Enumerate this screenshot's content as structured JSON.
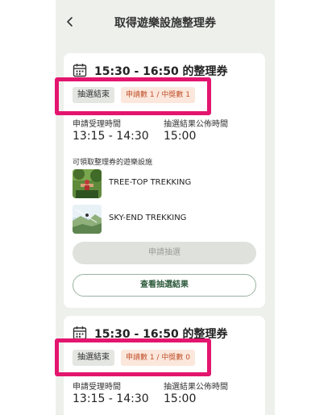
{
  "header": {
    "title": "取得遊樂設施整理券"
  },
  "labels": {
    "apply_time": "申請受理時間",
    "announce_time": "抽選結果公佈時間",
    "facilities": "可領取整理券的遊樂設施"
  },
  "cards": [
    {
      "time_range": "15:30 - 16:50 的整理券",
      "status": "抽選結束",
      "count": "申請數 1 / 中獎數 1",
      "apply_time": "13:15 - 14:30",
      "announce_time": "15:00",
      "facilities": [
        {
          "name": "TREE-TOP TREKKING"
        },
        {
          "name": "SKY-END TREKKING"
        }
      ],
      "apply_button": "申請抽選",
      "result_button": "查看抽選結果"
    },
    {
      "time_range": "15:30 - 16:50 的整理券",
      "status": "抽選結束",
      "count": "申請數 1 / 中獎數 0",
      "apply_time": "13:15 - 14:30",
      "announce_time": "15:00"
    }
  ],
  "colors": {
    "highlight": "#e3156e",
    "count_badge_text": "#c0502a",
    "accent_green": "#2c5a3b"
  }
}
